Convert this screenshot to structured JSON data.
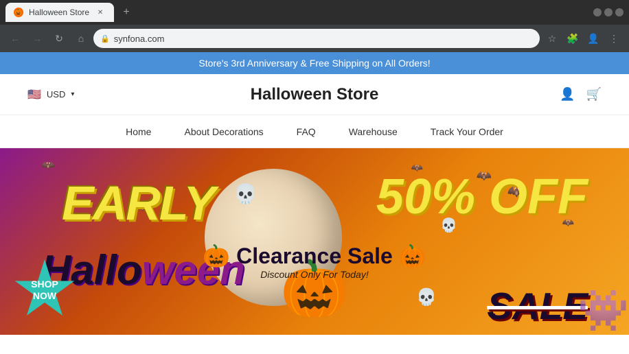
{
  "browser": {
    "tab": {
      "favicon": "🎃",
      "title": "Halloween Store",
      "active": true
    },
    "address": "synfona.com",
    "new_tab_label": "+"
  },
  "announcement": {
    "text": "Store's 3rd Anniversary & Free Shipping on All Orders!"
  },
  "header": {
    "title": "Halloween Store",
    "currency": {
      "flag": "🇺🇸",
      "code": "USD",
      "chevron": "▾"
    }
  },
  "nav": {
    "items": [
      {
        "label": "Home",
        "id": "home"
      },
      {
        "label": "About Decorations",
        "id": "about-decorations"
      },
      {
        "label": "FAQ",
        "id": "faq"
      },
      {
        "label": "Warehouse",
        "id": "warehouse"
      },
      {
        "label": "Track Your Order",
        "id": "track-order"
      }
    ]
  },
  "hero": {
    "early_text": "EARLY",
    "halloween_text": "Hallo ween",
    "fifty_off": "50% OFF",
    "sale_text": "SALE",
    "shop_now": "SHOP\nNOW",
    "clearance_title": "🎃 Clearance Sale 🎃",
    "clearance_subtitle": "Discount Only For Today!"
  }
}
